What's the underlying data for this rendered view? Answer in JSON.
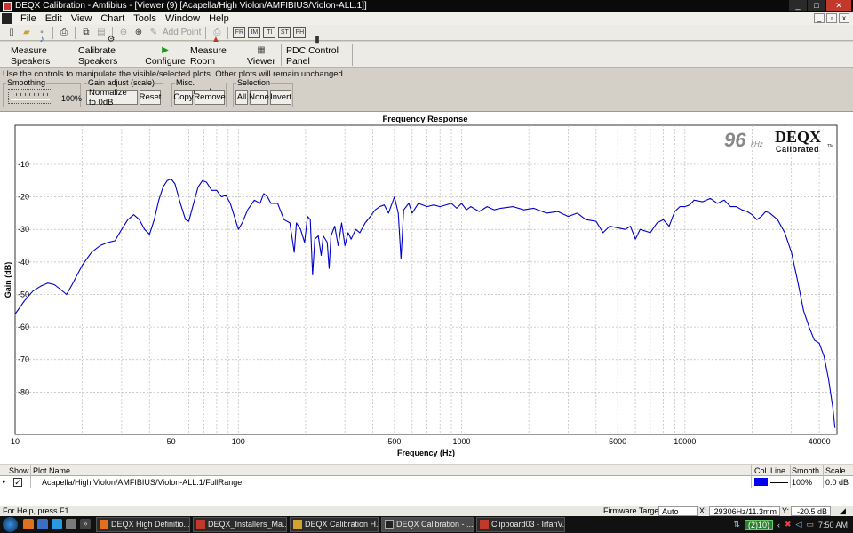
{
  "window": {
    "title": "DEQX Calibration - Amfibius - [Viewer (9) [Acapella/High Violon/AMFIBIUS/Violon-ALL.1]]"
  },
  "menu": [
    "File",
    "Edit",
    "View",
    "Chart",
    "Tools",
    "Window",
    "Help"
  ],
  "toolbar1": {
    "add_point_label": "Add Point",
    "icons": [
      "new-icon",
      "open-icon",
      "save-icon",
      "print-icon",
      "copy-icon",
      "paste-icon",
      "zoom-out-icon",
      "zoom-in-icon",
      "add-point-icon",
      "printer-icon",
      "freq-icon",
      "impulse-icon",
      "time-icon",
      "step-icon",
      "phase-icon"
    ]
  },
  "toolbar2": {
    "buttons": [
      "Measure Speakers",
      "Calibrate Speakers",
      "Configure",
      "Measure Room",
      "Viewer",
      "PDC Control Panel"
    ]
  },
  "hint": "Use the controls to manipulate the visible/selected plots.  Other plots will remain unchanged.",
  "controls": {
    "smoothing": {
      "label": "Smoothing",
      "value": "100%"
    },
    "gain": {
      "label": "Gain adjust (scale)",
      "normalize": "Normalize to 0dB",
      "reset": "Reset"
    },
    "misc": {
      "label": "Misc. commands",
      "copy": "Copy",
      "remove": "Remove"
    },
    "selection": {
      "label": "Selection",
      "all": "All",
      "none": "None",
      "invert": "Invert"
    }
  },
  "chart_data": {
    "type": "line",
    "title": "Frequency Response",
    "xlabel": "Frequency (Hz)",
    "ylabel": "Gain (dB)",
    "x_scale": "log",
    "xlim": [
      10,
      48000
    ],
    "ylim": [
      -93,
      2
    ],
    "x_ticks": [
      10,
      50,
      100,
      500,
      1000,
      5000,
      10000,
      40000
    ],
    "y_ticks": [
      -10,
      -20,
      -30,
      -40,
      -50,
      -60,
      -70,
      -80
    ],
    "grid": true,
    "badge": {
      "rate": "96",
      "unit": "kHz",
      "brand": "DEQX",
      "sub": "Calibrated",
      "tm": "TM"
    },
    "series": [
      {
        "color": "#0000cc",
        "points": [
          [
            10,
            -56
          ],
          [
            11,
            -52
          ],
          [
            12,
            -49
          ],
          [
            13,
            -47.5
          ],
          [
            14,
            -46.5
          ],
          [
            15,
            -47
          ],
          [
            16,
            -48.5
          ],
          [
            17,
            -50
          ],
          [
            18,
            -47
          ],
          [
            20,
            -41
          ],
          [
            22,
            -37
          ],
          [
            24,
            -35
          ],
          [
            26,
            -34
          ],
          [
            28,
            -33.5
          ],
          [
            30,
            -30
          ],
          [
            32,
            -27
          ],
          [
            34,
            -25.5
          ],
          [
            36,
            -27
          ],
          [
            38,
            -30
          ],
          [
            40,
            -31.5
          ],
          [
            42,
            -27
          ],
          [
            44,
            -21
          ],
          [
            46,
            -17
          ],
          [
            48,
            -15
          ],
          [
            50,
            -14.5
          ],
          [
            52,
            -16
          ],
          [
            55,
            -22
          ],
          [
            58,
            -27
          ],
          [
            60,
            -27.5
          ],
          [
            63,
            -22
          ],
          [
            66,
            -17
          ],
          [
            69,
            -15
          ],
          [
            72,
            -15.5
          ],
          [
            76,
            -18
          ],
          [
            80,
            -18
          ],
          [
            84,
            -20
          ],
          [
            88,
            -19.5
          ],
          [
            92,
            -22
          ],
          [
            96,
            -26
          ],
          [
            100,
            -30
          ],
          [
            104,
            -28
          ],
          [
            110,
            -24
          ],
          [
            118,
            -21
          ],
          [
            125,
            -22
          ],
          [
            130,
            -19
          ],
          [
            135,
            -20
          ],
          [
            140,
            -22
          ],
          [
            150,
            -22
          ],
          [
            160,
            -27
          ],
          [
            170,
            -28
          ],
          [
            178,
            -37
          ],
          [
            182,
            -28
          ],
          [
            190,
            -30
          ],
          [
            198,
            -34
          ],
          [
            204,
            -26
          ],
          [
            210,
            -27
          ],
          [
            215,
            -44
          ],
          [
            220,
            -33
          ],
          [
            228,
            -32
          ],
          [
            235,
            -38
          ],
          [
            240,
            -32
          ],
          [
            250,
            -34
          ],
          [
            255,
            -42
          ],
          [
            260,
            -32
          ],
          [
            270,
            -29
          ],
          [
            280,
            -35
          ],
          [
            290,
            -28
          ],
          [
            300,
            -35
          ],
          [
            310,
            -31
          ],
          [
            320,
            -33
          ],
          [
            335,
            -30
          ],
          [
            350,
            -31
          ],
          [
            370,
            -28
          ],
          [
            390,
            -26
          ],
          [
            410,
            -24
          ],
          [
            430,
            -23
          ],
          [
            450,
            -22.5
          ],
          [
            470,
            -25
          ],
          [
            500,
            -20
          ],
          [
            520,
            -25
          ],
          [
            535,
            -39
          ],
          [
            550,
            -24
          ],
          [
            580,
            -22
          ],
          [
            600,
            -25
          ],
          [
            640,
            -22
          ],
          [
            700,
            -23
          ],
          [
            750,
            -22.5
          ],
          [
            800,
            -23
          ],
          [
            900,
            -22
          ],
          [
            950,
            -23.5
          ],
          [
            1000,
            -22
          ],
          [
            1050,
            -24
          ],
          [
            1100,
            -23
          ],
          [
            1200,
            -24.5
          ],
          [
            1300,
            -23
          ],
          [
            1400,
            -24
          ],
          [
            1500,
            -23.5
          ],
          [
            1700,
            -23
          ],
          [
            1900,
            -24
          ],
          [
            2100,
            -23.5
          ],
          [
            2400,
            -25
          ],
          [
            2700,
            -24.5
          ],
          [
            3000,
            -26
          ],
          [
            3300,
            -25
          ],
          [
            3600,
            -27
          ],
          [
            4000,
            -27.5
          ],
          [
            4300,
            -31
          ],
          [
            4600,
            -29
          ],
          [
            5000,
            -29.5
          ],
          [
            5400,
            -30
          ],
          [
            5700,
            -29
          ],
          [
            6000,
            -33
          ],
          [
            6300,
            -30
          ],
          [
            7000,
            -31
          ],
          [
            7500,
            -28
          ],
          [
            8000,
            -27
          ],
          [
            8500,
            -29
          ],
          [
            9000,
            -24.5
          ],
          [
            9500,
            -23
          ],
          [
            10000,
            -23
          ],
          [
            10500,
            -22.5
          ],
          [
            11000,
            -21
          ],
          [
            12000,
            -21.5
          ],
          [
            13000,
            -20.5
          ],
          [
            14000,
            -22
          ],
          [
            15000,
            -21
          ],
          [
            16000,
            -23
          ],
          [
            17000,
            -23
          ],
          [
            18000,
            -24
          ],
          [
            19000,
            -24.5
          ],
          [
            20000,
            -25.5
          ],
          [
            21000,
            -27
          ],
          [
            22000,
            -26
          ],
          [
            23000,
            -24.5
          ],
          [
            24000,
            -25
          ],
          [
            26000,
            -27
          ],
          [
            28000,
            -31
          ],
          [
            30000,
            -37
          ],
          [
            32000,
            -46
          ],
          [
            34000,
            -55
          ],
          [
            36000,
            -60
          ],
          [
            38000,
            -64
          ],
          [
            40000,
            -65
          ],
          [
            42000,
            -69
          ],
          [
            44000,
            -76
          ],
          [
            46000,
            -85
          ],
          [
            47000,
            -91
          ]
        ]
      }
    ]
  },
  "plot_table": {
    "headers": [
      "Show",
      "Plot Name",
      "Col",
      "Line",
      "Smooth",
      "Scale"
    ],
    "rows": [
      {
        "name": "Acapella/High Violon/AMFIBIUS/Violon-ALL.1/FullRange",
        "smooth": "100%",
        "scale": "0.0 dB"
      }
    ]
  },
  "status": {
    "help": "For Help, press F1",
    "firmware_label": "Firmware Target:",
    "firmware_value": "Auto",
    "x_label": "X:",
    "x_value": "29306Hz/11.3mm",
    "y_label": "Y:",
    "y_value": "-20.5 dB"
  },
  "taskbar": {
    "tasks": [
      "DEQX High Definitio...",
      "DEQX_Installers_Ma...",
      "DEQX Calibration H...",
      "DEQX Calibration - ...",
      "Clipboard03 - IrfanV..."
    ],
    "lang": "(2)10)",
    "time": "7:50 AM"
  }
}
